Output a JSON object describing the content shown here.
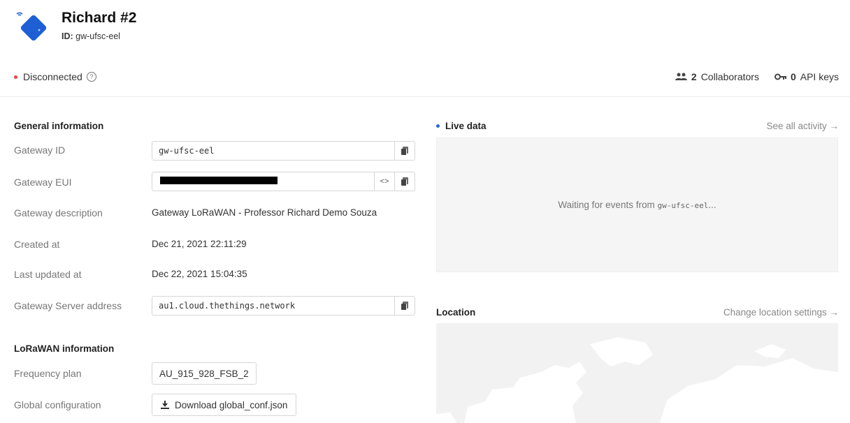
{
  "gateway": {
    "title": "Richard #2",
    "id_label": "ID:",
    "id_value": "gw-ufsc-eel",
    "status": "Disconnected"
  },
  "header_meta": {
    "collaborators_count": "2",
    "collaborators_label": "Collaborators",
    "api_keys_count": "0",
    "api_keys_label": "API keys"
  },
  "general": {
    "title": "General information",
    "gateway_id_label": "Gateway ID",
    "gateway_id_value": "gw-ufsc-eel",
    "gateway_eui_label": "Gateway EUI",
    "description_label": "Gateway description",
    "description_value": "Gateway LoRaWAN - Professor Richard Demo Souza",
    "created_label": "Created at",
    "created_value": "Dec 21, 2021 22:11:29",
    "updated_label": "Last updated at",
    "updated_value": "Dec 22, 2021 15:04:35",
    "server_label": "Gateway Server address",
    "server_value": "au1.cloud.thethings.network"
  },
  "lorawan": {
    "title": "LoRaWAN information",
    "freq_label": "Frequency plan",
    "freq_value": "AU_915_928_FSB_2",
    "global_label": "Global configuration",
    "download_label": "Download global_conf.json"
  },
  "live": {
    "title": "Live data",
    "link": "See all activity →",
    "waiting_prefix": "Waiting for events from",
    "waiting_id": "gw-ufsc-eel",
    "waiting_suffix": "..."
  },
  "location": {
    "title": "Location",
    "link": "Change location settings →"
  },
  "colors": {
    "status_red": "#e54545",
    "live_blue": "#2a65db",
    "icon_blue": "#1f5fd6"
  }
}
